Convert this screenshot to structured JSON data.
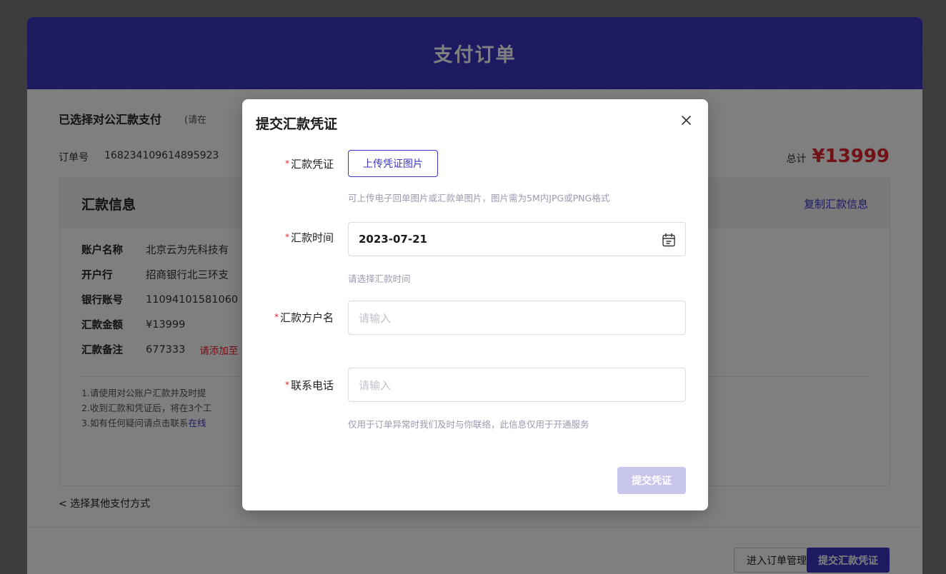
{
  "page": {
    "title": "支付订单",
    "selected_method": "已选择对公汇款支付",
    "selected_hint": "(请在",
    "order_label": "订单号",
    "order_no": "168234109614895923",
    "total_label": "总计",
    "total_amount": "¥13999",
    "remit": {
      "title": "汇款信息",
      "copy_label": "复制汇款信息",
      "rows": [
        {
          "key": "账户名称",
          "value": "北京云为先科技有"
        },
        {
          "key": "开户行",
          "value": "招商银行北三环支"
        },
        {
          "key": "银行账号",
          "value": "11094101581060"
        },
        {
          "key": "汇款金额",
          "value": "¥13999"
        },
        {
          "key": "汇款备注",
          "value": "677333",
          "note": "请添加至"
        }
      ],
      "notes": [
        "1.请使用对公账户汇款并及时提",
        "2.收到汇款和凭证后，将在3个工",
        "3.如有任何疑问请点击联系"
      ],
      "note_link": "在线"
    },
    "back_link": "< 选择其他支付方式",
    "manage_btn": "进入订单管理",
    "submit_btn": "提交汇款凭证"
  },
  "modal": {
    "title": "提交汇款凭证",
    "fields": {
      "voucher": {
        "label": "汇款凭证",
        "button": "上传凭证图片",
        "help": "可上传电子回单图片或汇款单图片，图片需为5M内JPG或PNG格式"
      },
      "time": {
        "label": "汇款时间",
        "value": "2023-07-21",
        "help": "请选择汇款时间"
      },
      "payer": {
        "label": "汇款方户名",
        "placeholder": "请输入"
      },
      "phone": {
        "label": "联系电话",
        "placeholder": "请输入",
        "help": "仅用于订单异常时我们及时与你联络，此信息仅用于开通服务"
      }
    },
    "submit": "提交凭证"
  },
  "icons": {
    "close": "close-icon",
    "calendar": "calendar-icon"
  },
  "colors": {
    "brand": "#3b35c4",
    "price_red": "#e0242f",
    "submit_disabled": "#c9c6ee"
  }
}
